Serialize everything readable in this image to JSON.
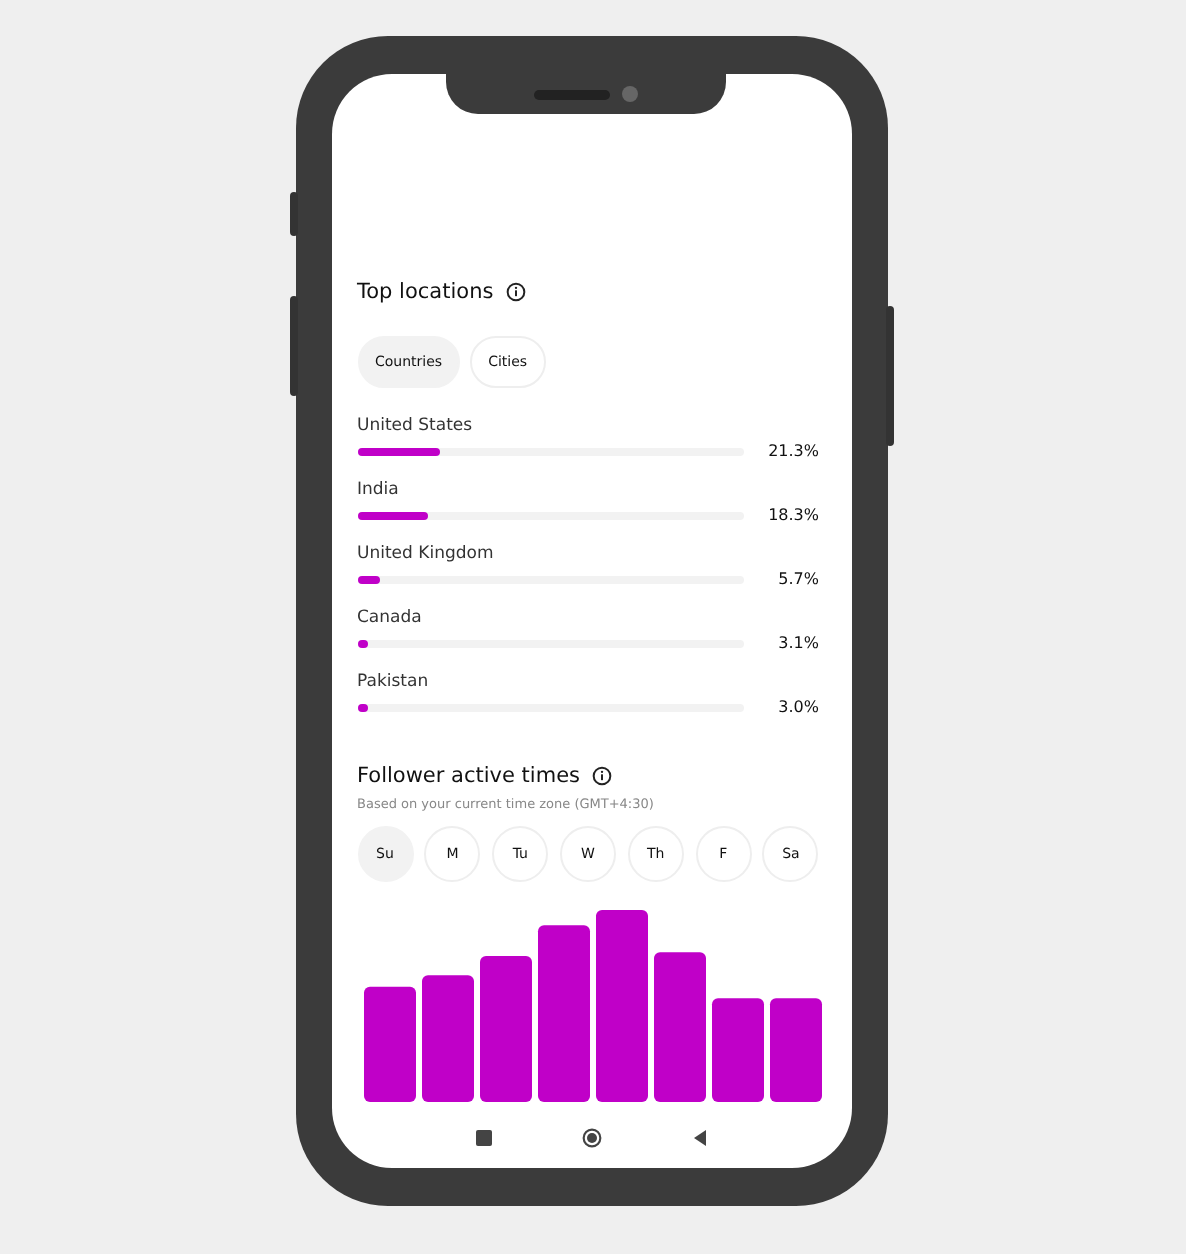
{
  "top_locations": {
    "title": "Top locations",
    "filters": [
      {
        "label": "Countries",
        "selected": true
      },
      {
        "label": "Cities",
        "selected": false
      }
    ],
    "rows": [
      {
        "name": "United States",
        "level": 0.213,
        "reading": "21.3%"
      },
      {
        "name": "India",
        "level": 0.183,
        "reading": "18.3%"
      },
      {
        "name": "United Kingdom",
        "level": 0.057,
        "reading": "5.7%"
      },
      {
        "name": "Canada",
        "level": 0.031,
        "reading": "3.1%"
      },
      {
        "name": "Pakistan",
        "level": 0.03,
        "reading": "3.0%"
      }
    ]
  },
  "active_times": {
    "title": "Follower active times",
    "subtitle": "Based on your current time zone (GMT+4:30)",
    "days": [
      {
        "label": "Su",
        "selected": true
      },
      {
        "label": "M",
        "selected": false
      },
      {
        "label": "Tu",
        "selected": false
      },
      {
        "label": "W",
        "selected": false
      },
      {
        "label": "Th",
        "selected": false
      },
      {
        "label": "F",
        "selected": false
      },
      {
        "label": "Sa",
        "selected": false
      }
    ]
  }
}
